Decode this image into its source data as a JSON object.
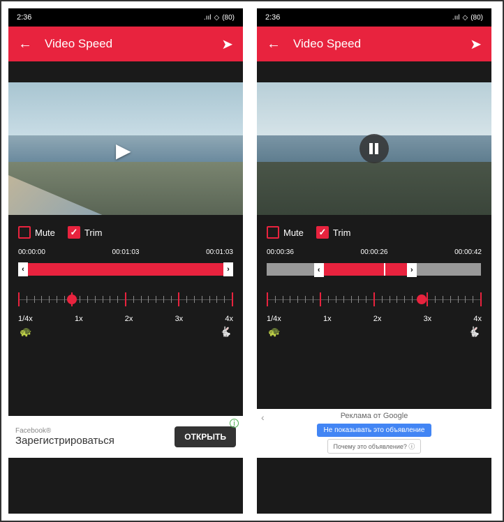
{
  "status": {
    "time": "2:36",
    "signal": ".ıll",
    "wifi": "⬡",
    "battery": "80"
  },
  "appBar": {
    "title": "Video Speed"
  },
  "left": {
    "mute": {
      "label": "Mute",
      "checked": false
    },
    "trim": {
      "label": "Trim",
      "checked": true
    },
    "times": {
      "start": "00:00:00",
      "current": "00:01:03",
      "end": "00:01:03"
    },
    "speed": {
      "labels": [
        "1/4x",
        "1x",
        "2x",
        "3x",
        "4x"
      ],
      "knob_pct": 25
    },
    "ad": {
      "brand": "Facebook®",
      "text": "Зарегистрироваться",
      "button": "ОТКРЫТЬ"
    }
  },
  "right": {
    "mute": {
      "label": "Mute",
      "checked": false
    },
    "trim": {
      "label": "Trim",
      "checked": true
    },
    "times": {
      "start": "00:00:36",
      "current": "00:00:26",
      "end": "00:00:42"
    },
    "speed": {
      "labels": [
        "1/4x",
        "1x",
        "2x",
        "3x",
        "4x"
      ],
      "knob_pct": 72
    },
    "ad": {
      "title": "Реклама от Google",
      "skip": "Не показывать это объявление",
      "why": "Почему это объявление? ⓘ"
    }
  }
}
